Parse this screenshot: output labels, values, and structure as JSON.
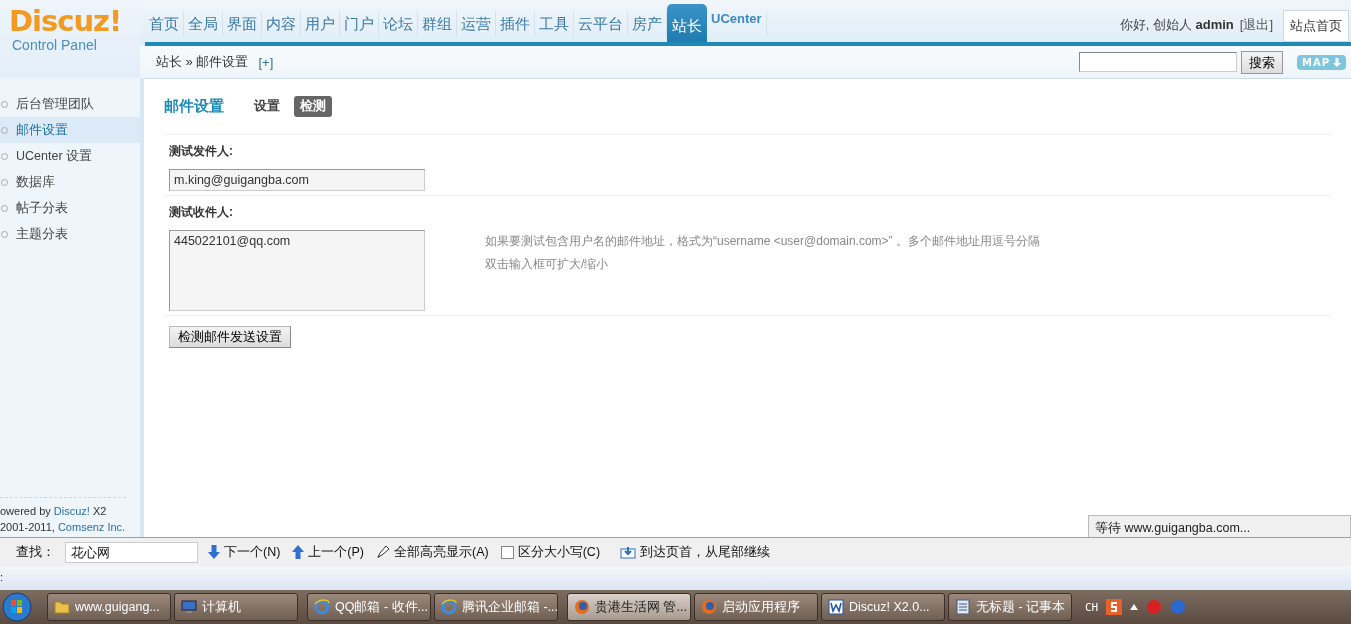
{
  "logo": {
    "brand": "Discuz!",
    "subtitle": "Control Panel"
  },
  "nav": [
    {
      "label": "首页",
      "selected": false
    },
    {
      "label": "全局",
      "selected": false
    },
    {
      "label": "界面",
      "selected": false
    },
    {
      "label": "内容",
      "selected": false
    },
    {
      "label": "用户",
      "selected": false
    },
    {
      "label": "门户",
      "selected": false
    },
    {
      "label": "论坛",
      "selected": false
    },
    {
      "label": "群组",
      "selected": false
    },
    {
      "label": "运营",
      "selected": false
    },
    {
      "label": "插件",
      "selected": false
    },
    {
      "label": "工具",
      "selected": false
    },
    {
      "label": "云平台",
      "selected": false
    },
    {
      "label": "房产",
      "selected": false
    },
    {
      "label": "站长",
      "selected": true
    },
    {
      "label": "UCenter",
      "selected": false
    }
  ],
  "user": {
    "greeting": "你好, 创始人",
    "name": "admin",
    "logout": "[退出]",
    "home_button": "站点首页"
  },
  "breadcrumb": {
    "path": "站长 » 邮件设置",
    "add": "[+]"
  },
  "search": {
    "button": "搜索",
    "map": "MAP"
  },
  "sidebar": {
    "items": [
      {
        "label": "后台管理团队",
        "selected": false
      },
      {
        "label": "邮件设置",
        "selected": true
      },
      {
        "label": "UCenter 设置",
        "selected": false
      },
      {
        "label": "数据库",
        "selected": false
      },
      {
        "label": "帖子分表",
        "selected": false
      },
      {
        "label": "主题分表",
        "selected": false
      }
    ],
    "footer": [
      {
        "text": "owered by",
        "link": "Discuz!",
        "suffix": "X2"
      },
      {
        "text": "2001-2011,",
        "link": "Comsenz Inc."
      }
    ]
  },
  "page": {
    "title": "邮件设置",
    "tabs": [
      {
        "label": "设置",
        "selected": false
      },
      {
        "label": "检测",
        "selected": true
      }
    ],
    "fields": [
      {
        "label": "测试发件人:",
        "kind": "input",
        "value": "m.king@guigangba.com"
      },
      {
        "label": "测试收件人:",
        "kind": "textarea",
        "value": "445022101@qq.com",
        "hints": [
          "如果要测试包含用户名的邮件地址，格式为“username <user@domain.com>” 。多个邮件地址用逗号分隔",
          "双击输入框可扩大/缩小"
        ]
      }
    ],
    "submit": "检测邮件发送设置"
  },
  "status_popup": "等待 www.guigangba.com...",
  "find_bar": {
    "label": "查找：",
    "value": "花心网",
    "next": "下一个(N)",
    "prev": "上一个(P)",
    "highlight": "全部高亮显示(A)",
    "match_case": {
      "label": "区分大小写(C)",
      "checked": false
    },
    "notice": "到达页首，从尾部继续"
  },
  "status_line": ":",
  "taskbar": {
    "items": [
      {
        "label": "www.guigang...",
        "kind": "folder",
        "selected": false
      },
      {
        "label": "计算机",
        "kind": "computer",
        "selected": false
      },
      {
        "label": "QQ邮箱 - 收件...",
        "kind": "ie",
        "selected": false
      },
      {
        "label": "腾讯企业邮箱 -...",
        "kind": "ie",
        "selected": false
      },
      {
        "label": "贵港生活网 管...",
        "kind": "firefox",
        "selected": true
      },
      {
        "label": "启动应用程序",
        "kind": "firefox",
        "selected": false
      },
      {
        "label": "Discuz! X2.0...",
        "kind": "word",
        "selected": false
      },
      {
        "label": "无标题 - 记事本",
        "kind": "notepad",
        "selected": false
      }
    ],
    "language": "CH"
  }
}
